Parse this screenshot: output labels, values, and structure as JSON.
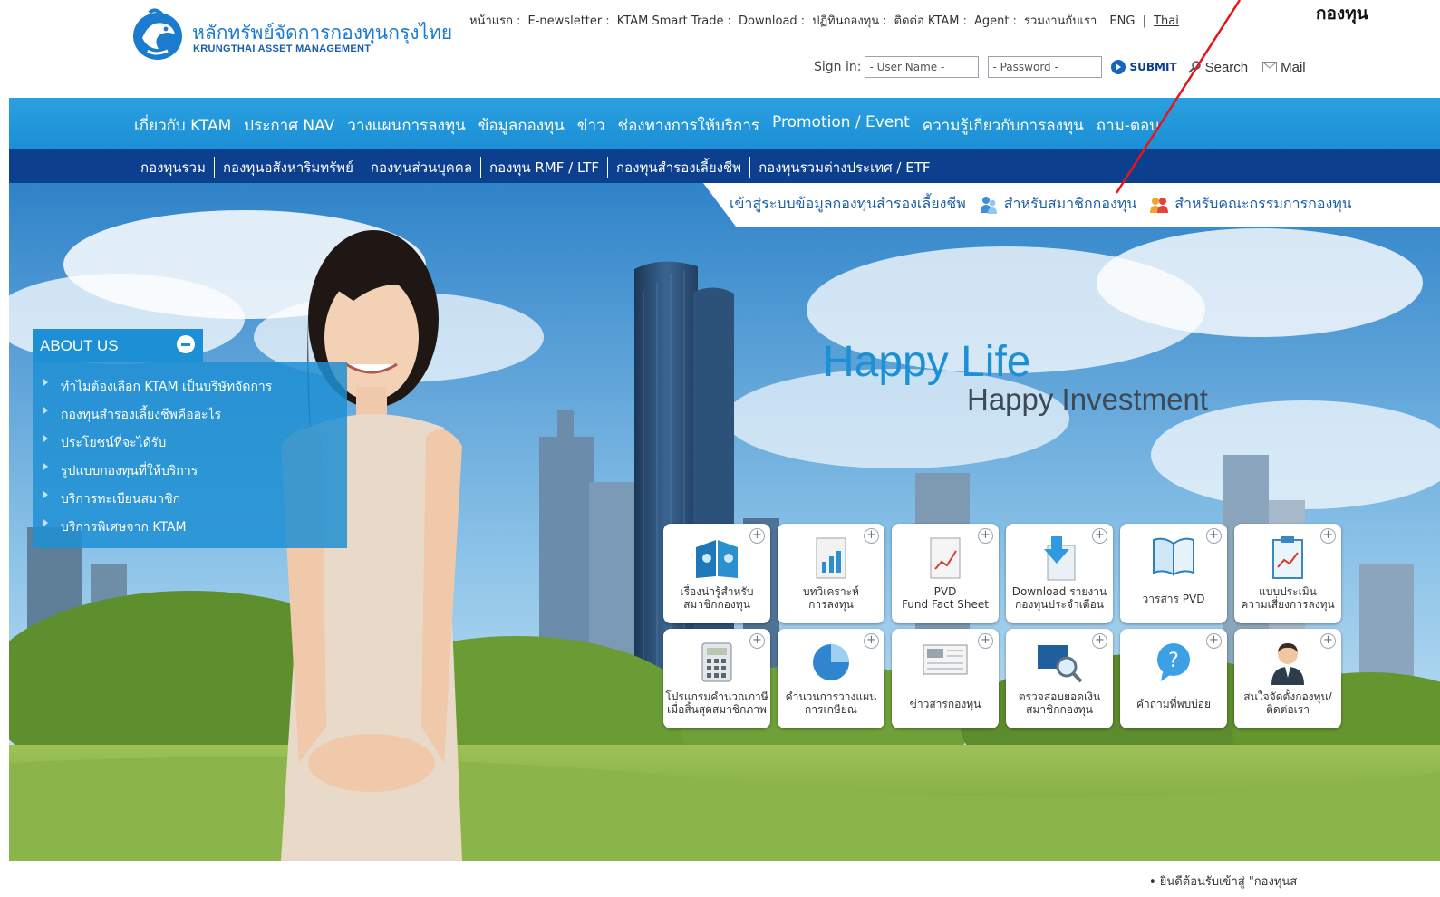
{
  "header": {
    "logo_th": "หลักทรัพย์จัดการกองทุนกรุงไทย",
    "logo_en": "KRUNGTHAI ASSET MANAGEMENT",
    "top_links": [
      "หน้าแรก",
      "E-newsletter",
      "KTAM Smart Trade",
      "Download",
      "ปฏิทินกองทุน",
      "ติดต่อ KTAM",
      "Agent",
      "ร่วมงานกับเรา"
    ],
    "lang_eng": "ENG",
    "lang_thai": "Thai",
    "corner_note": "กองทุน",
    "signin_label": "Sign in:",
    "username_value": "- User Name -",
    "password_value": "- Password -",
    "submit_label": "SUBMIT",
    "search_label": "Search",
    "mail_label": "Mail"
  },
  "main_nav": [
    "เกี่ยวกับ KTAM",
    "ประกาศ NAV",
    "วางแผนการลงทุน",
    "ข้อมูลกองทุน",
    "ข่าว",
    "ช่องทางการให้บริการ",
    "Promotion / Event",
    "ความรู้เกี่ยวกับการลงทุน",
    "ถาม-ตอบ"
  ],
  "sub_nav": [
    "กองทุนรวม",
    "กองทุนอสังหาริมทรัพย์",
    "กองทุนส่วนบุคคล",
    "กองทุน RMF / LTF",
    "กองทุนสำรองเลี้ยงชีพ",
    "กองทุนรวมต่างประเทศ / ETF"
  ],
  "pvd_bar": {
    "label": "เข้าสู่ระบบข้อมูลกองทุนสำรองเลี้ยงชีพ",
    "member_link": "สำหรับสมาชิกกองทุน",
    "committee_link": "สำหรับคณะกรรมการกองทุน"
  },
  "about": {
    "title": "ABOUT US",
    "items": [
      "ทำไมต้องเลือก KTAM เป็นบริษัทจัดการ",
      "กองทุนสำรองเลี้ยงชีพคืออะไร",
      "ประโยชน์ที่จะได้รับ",
      "รูปแบบกองทุนที่ให้บริการ",
      "บริการทะเบียนสมาชิก",
      "บริการพิเศษจาก KTAM"
    ]
  },
  "slogan": {
    "line1": "Happy Life",
    "line2": "Happy Investment"
  },
  "tiles": [
    {
      "label": "เรื่องน่ารู้สำหรับ\nสมาชิกกองทุน",
      "icon": "books-icon"
    },
    {
      "label": "บทวิเคราะห์\nการลงทุน",
      "icon": "report-icon"
    },
    {
      "label": "PVD\nFund Fact Sheet",
      "icon": "fact-sheet-icon"
    },
    {
      "label": "Download รายงาน\nกองทุนประจำเดือน",
      "icon": "download-icon"
    },
    {
      "label": "วารสาร PVD",
      "icon": "journal-icon"
    },
    {
      "label": "แบบประเมิน\nความเสี่ยงการลงทุน",
      "icon": "clipboard-icon"
    },
    {
      "label": "โปรแกรมคำนวณภาษี\nเมื่อสิ้นสุดสมาชิกภาพ",
      "icon": "calculator-icon"
    },
    {
      "label": "คำนวนการวางแผน\nการเกษียณ",
      "icon": "pie-chart-icon"
    },
    {
      "label": "ข่าวสารกองทุน",
      "icon": "newspaper-icon"
    },
    {
      "label": "ตรวจสอบยอดเงิน\nสมาชิกกองทุน",
      "icon": "magnifier-icon"
    },
    {
      "label": "คำถามที่พบบ่อย",
      "icon": "question-icon"
    },
    {
      "label": "สนใจจัดตั้งกองทุน/\nติดต่อเรา",
      "icon": "contact-person-icon"
    }
  ],
  "bottom": {
    "welcome": "• ยินดีต้อนรับเข้าสู่ \"กองทุนส"
  },
  "colors": {
    "main_nav": "#1c8fd6",
    "sub_nav": "#0d3f8f",
    "accent": "#1d8fd4",
    "annotation_arrow": "#e8141a"
  }
}
